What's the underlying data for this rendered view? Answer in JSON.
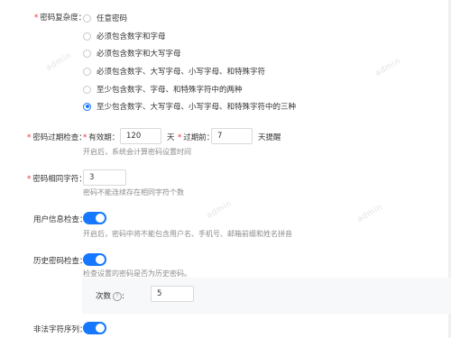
{
  "colors": {
    "accent": "#1677ff",
    "required": "#f5222d",
    "hint": "#8c8c8c"
  },
  "watermark": "admin",
  "complexity": {
    "label": "密码复杂度：",
    "options": [
      "任意密码",
      "必须包含数字和字母",
      "必须包含数字和大写字母",
      "必须包含数字、大写字母、小写字母、和特殊字符",
      "至少包含数字、字母、和特殊字符中的两种",
      "至少包含数字、大写字母、小写字母、和特殊字符中的三种"
    ],
    "selected_index": 5
  },
  "expiry": {
    "label": "密码过期检查：",
    "validity_label": "有效期：",
    "validity_value": "120",
    "validity_unit": "天",
    "before_label": "过期前：",
    "before_value": "7",
    "before_unit": "天提醒",
    "hint": "开启后，系统会计算密码设置时间"
  },
  "same_char": {
    "label": "密码相同字符：",
    "value": "3",
    "hint": "密码不能连续存在相同字符个数"
  },
  "user_info": {
    "label": "用户信息检查：",
    "enabled": true,
    "hint": "开启后，密码中将不能包含用户名、手机号、邮箱前缀和姓名拼音"
  },
  "history": {
    "label": "历史密码检查：",
    "enabled": true,
    "hint": "检查设置的密码是否为历史密码。",
    "count_label": "次数",
    "count_value": "5"
  },
  "illegal_seq": {
    "label": "非法字符序列：",
    "enabled": true
  }
}
